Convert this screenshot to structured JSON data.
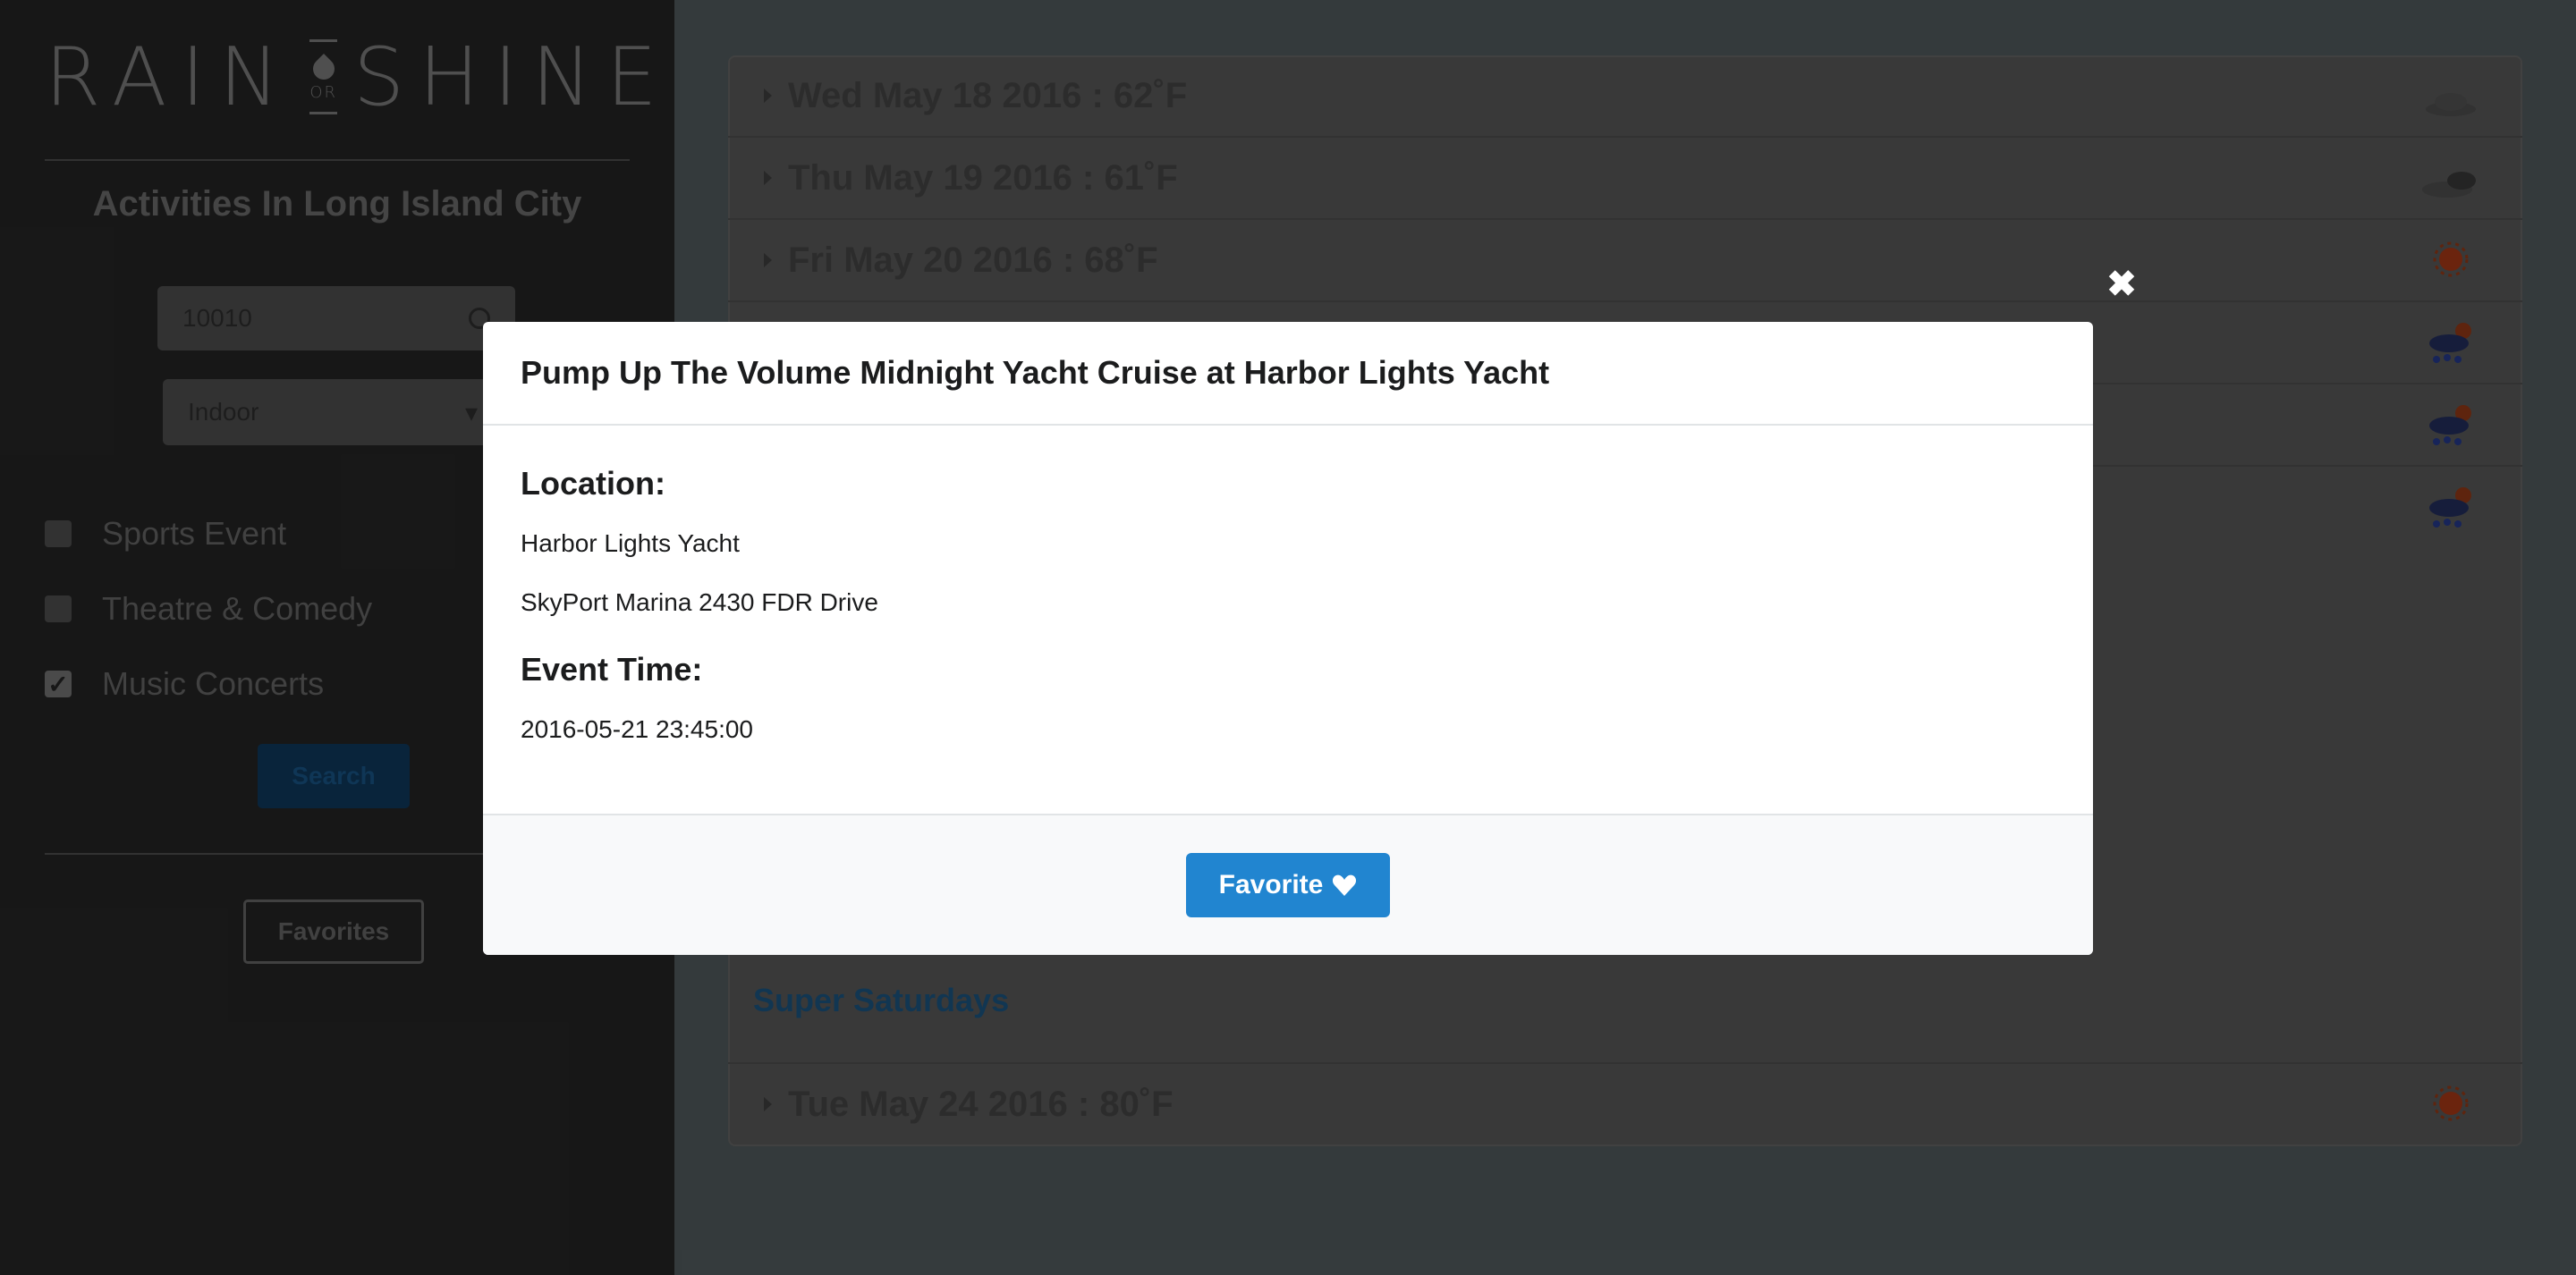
{
  "sidebar": {
    "logo": {
      "left": "RAIN",
      "mid": "OR",
      "right": "SHINE"
    },
    "title": "Activities In Long Island City",
    "zip_value": "10010",
    "select_value": "Indoor",
    "categories": [
      {
        "label": "Sports Event",
        "checked": false
      },
      {
        "label": "Theatre & Comedy",
        "checked": false
      },
      {
        "label": "Music Concerts",
        "checked": true
      }
    ],
    "search_label": "Search",
    "favorites_label": "Favorites"
  },
  "forecast": {
    "days": [
      {
        "label": "Wed May 18 2016 : 62˚F",
        "icon": "cloud-icon"
      },
      {
        "label": "Thu May 19 2016 : 61˚F",
        "icon": "partly-cloudy-icon"
      },
      {
        "label": "Fri May 20 2016 : 68˚F",
        "icon": "sun-icon"
      },
      {
        "label": "",
        "icon": "rain-sun-icon"
      },
      {
        "label": "",
        "icon": "rain-sun-icon"
      },
      {
        "label": "",
        "icon": "rain-sun-icon"
      }
    ],
    "event_link": "Super Saturdays",
    "last_day": {
      "label": "Tue May 24 2016 : 80˚F",
      "icon": "sun-icon"
    }
  },
  "modal": {
    "title": "Pump Up The Volume Midnight Yacht Cruise at Harbor Lights Yacht",
    "location_heading": "Location:",
    "venue": "Harbor Lights Yacht",
    "address": "SkyPort Marina 2430 FDR Drive",
    "time_heading": "Event Time:",
    "time": "2016-05-21 23:45:00",
    "favorite_label": "Favorite",
    "close_symbol": "✖"
  }
}
